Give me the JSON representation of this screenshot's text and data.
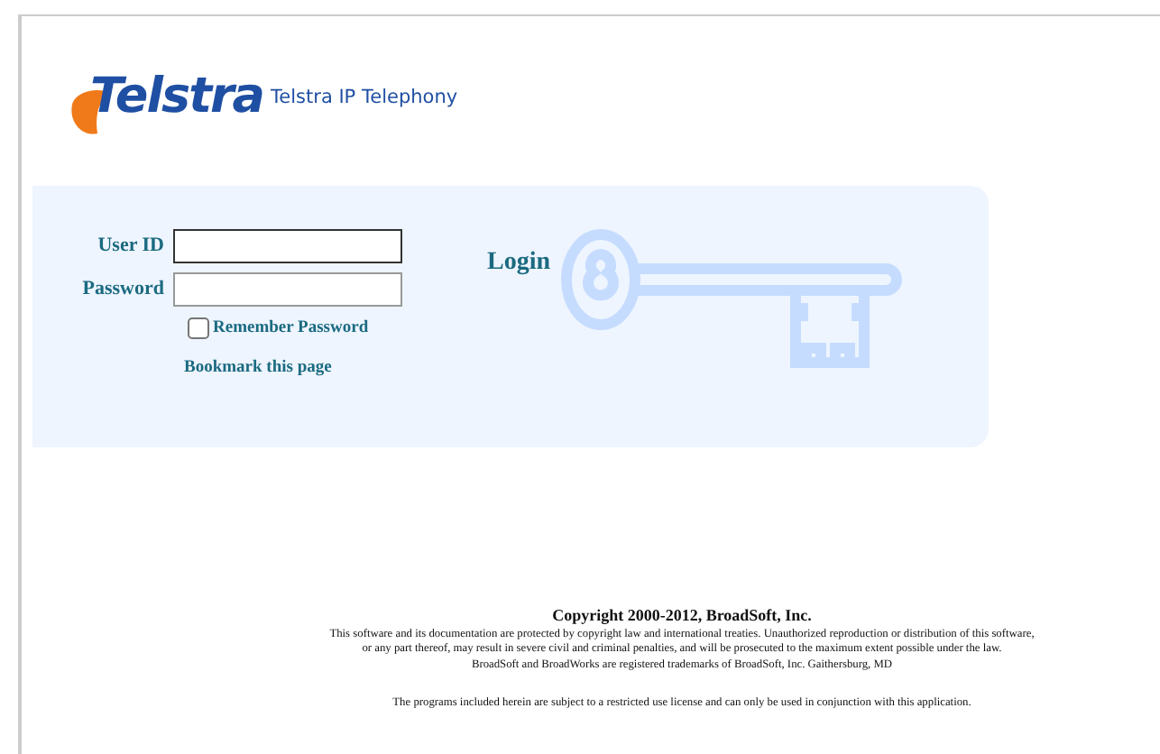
{
  "logo": {
    "wordmark": "Telstra",
    "product": "Telstra IP Telephony"
  },
  "login": {
    "title": "Login",
    "fields": [
      {
        "label": "User ID",
        "focused": true
      },
      {
        "label": "Password",
        "focused": false
      }
    ],
    "remember": {
      "label": "Remember Password",
      "checked": false
    },
    "bookmark": "Bookmark this page"
  },
  "footer": {
    "copyright": "Copyright 2000-2012, BroadSoft, Inc.",
    "notice": [
      "This software and its documentation are protected by copyright law and international treaties. Unauthorized reproduction or distribution of this software,",
      "or any part thereof, may result in severe civil and criminal penalties, and will be prosecuted to the maximum extent possible under the law.",
      "BroadSoft and BroadWorks are registered trademarks of BroadSoft, Inc. Gaithersburg, MD"
    ],
    "license": "The programs included herein are subject to a restricted use license and can only be used in conjunction with this application."
  }
}
